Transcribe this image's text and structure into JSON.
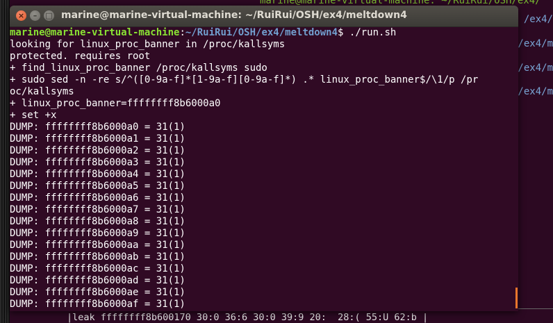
{
  "window": {
    "title": "marine@marine-virtual-machine: ~/RuiRui/OSH/ex4/meltdown4"
  },
  "background_window": {
    "title_fragment": "marine@marine-virtual-machine: ~/RuiRui/OSH/ex4/",
    "side_lines": [
      "/ex4/",
      "/ex4/m",
      "/ex4/m",
      "/ex4/m"
    ],
    "bottom_line": "|leak ffffffff8b600170 30:0 36:6 30:0 39:9 20:  28:( 55:U 62:b |"
  },
  "prompt": {
    "user_host": "marine@marine-virtual-machine",
    "path": "~/RuiRui/OSH/ex4/meltdown4",
    "symbol": "$",
    "command": " ./run.sh"
  },
  "output_lines": [
    "looking for linux_proc_banner in /proc/kallsyms",
    "protected. requires root",
    "+ find_linux_proc_banner /proc/kallsyms sudo",
    "+ sudo sed -n -re s/^([0-9a-f]*[1-9a-f][0-9a-f]*) .* linux_proc_banner$/\\1/p /pr",
    "oc/kallsyms",
    "+ linux_proc_banner=ffffffff8b6000a0",
    "+ set +x",
    "DUMP: ffffffff8b6000a0 = 31(1)",
    "DUMP: ffffffff8b6000a1 = 31(1)",
    "DUMP: ffffffff8b6000a2 = 31(1)",
    "DUMP: ffffffff8b6000a3 = 31(1)",
    "DUMP: ffffffff8b6000a4 = 31(1)",
    "DUMP: ffffffff8b6000a5 = 31(1)",
    "DUMP: ffffffff8b6000a6 = 31(1)",
    "DUMP: ffffffff8b6000a7 = 31(1)",
    "DUMP: ffffffff8b6000a8 = 31(1)",
    "DUMP: ffffffff8b6000a9 = 31(1)",
    "DUMP: ffffffff8b6000aa = 31(1)",
    "DUMP: ffffffff8b6000ab = 31(1)",
    "DUMP: ffffffff8b6000ac = 31(1)",
    "DUMP: ffffffff8b6000ad = 31(1)",
    "DUMP: ffffffff8b6000ae = 31(1)",
    "DUMP: ffffffff8b6000af = 31(1)"
  ],
  "colors": {
    "terminal_bg": "#300a24",
    "prompt_user": "#8ae234",
    "prompt_path": "#729fcf",
    "text": "#ffffff",
    "scroll_thumb": "#e9762b"
  }
}
